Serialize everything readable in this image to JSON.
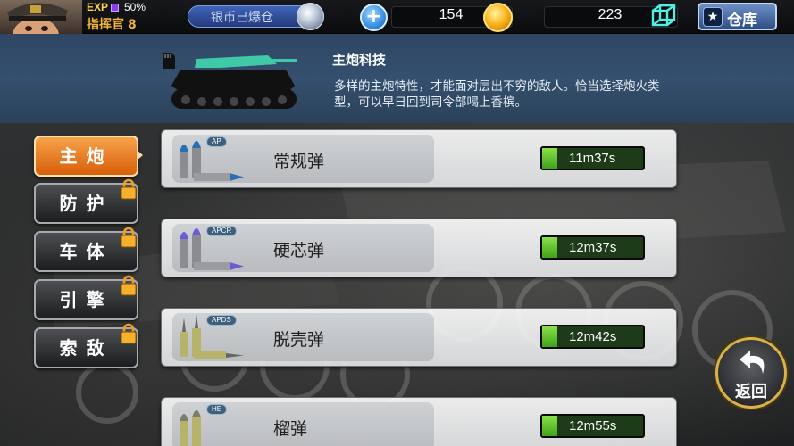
{
  "hud": {
    "exp_label": "EXP",
    "exp_percent": "50%",
    "exp_fill": 0.5,
    "rank_label": "指挥官",
    "rank_level": "8",
    "silver_status": "银币已爆仓",
    "gold": "154",
    "crystal": "223",
    "warehouse_label": "仓库"
  },
  "tech": {
    "title": "主炮科技",
    "description": "多样的主炮特性，才能面对层出不穷的敌人。恰当选择炮火类型，可以早日回到司令部喝上香槟。"
  },
  "tabs": [
    {
      "label": "主炮",
      "active": true,
      "locked": false
    },
    {
      "label": "防护",
      "active": false,
      "locked": true
    },
    {
      "label": "车体",
      "active": false,
      "locked": true
    },
    {
      "label": "引擎",
      "active": false,
      "locked": true
    },
    {
      "label": "索敌",
      "active": false,
      "locked": true
    }
  ],
  "ammo": [
    {
      "tag": "AP",
      "name": "常规弹",
      "timer": "11m37s",
      "progress": 0.15
    },
    {
      "tag": "APCR",
      "name": "硬芯弹",
      "timer": "12m37s",
      "progress": 0.15
    },
    {
      "tag": "APDS",
      "name": "脱壳弹",
      "timer": "12m42s",
      "progress": 0.15
    },
    {
      "tag": "HE",
      "name": "榴弹",
      "timer": "12m55s",
      "progress": 0.15
    }
  ],
  "back_label": "返回",
  "colors": {
    "active_tab": "#e8781f",
    "header_bg": "#34506f",
    "timer_green": "#5cc22a",
    "back_ring": "#d9b34a"
  }
}
